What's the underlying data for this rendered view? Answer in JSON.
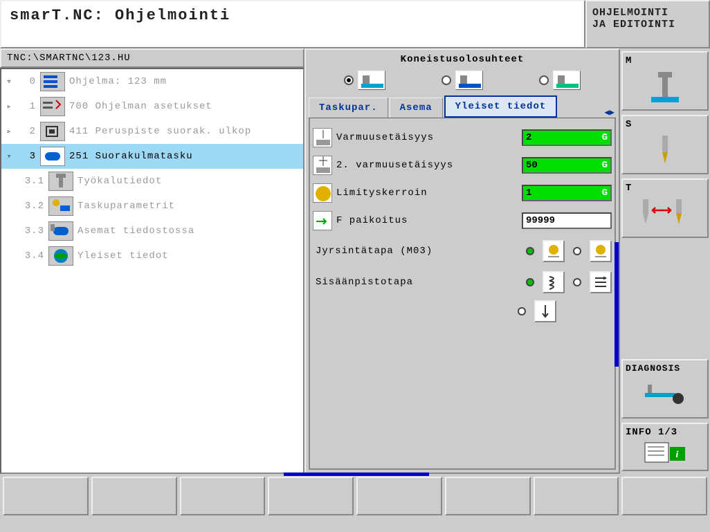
{
  "header": {
    "title": "smarT.NC: Ohjelmointi",
    "mode_line1": "OHJELMOINTI",
    "mode_line2": "JA EDITOINTI"
  },
  "file_path": "TNC:\\SMARTNC\\123.HU",
  "tree": [
    {
      "toggle": "▿",
      "num": "0",
      "label": "Ohjelma: 123 mm",
      "icon": "program"
    },
    {
      "toggle": "▹",
      "num": "1",
      "label": "700 Ohjelman asetukset",
      "icon": "settings"
    },
    {
      "toggle": "▹",
      "num": "2",
      "label": "411 Peruspiste suorak. ulkop",
      "icon": "datum"
    },
    {
      "toggle": "▿",
      "num": "3",
      "label": "251 Suorakulmatasku",
      "icon": "pocket",
      "selected": true
    },
    {
      "toggle": "",
      "num": "3.1",
      "label": "Työkalutiedot",
      "icon": "tool",
      "child": true
    },
    {
      "toggle": "",
      "num": "3.2",
      "label": "Taskuparametrit",
      "icon": "taskupar",
      "child": true
    },
    {
      "toggle": "",
      "num": "3.3",
      "label": "Asemat tiedostossa",
      "icon": "positions",
      "child": true
    },
    {
      "toggle": "",
      "num": "3.4",
      "label": "Yleiset tiedot",
      "icon": "global",
      "child": true
    }
  ],
  "panel": {
    "title": "Koneistusolosuhteet",
    "tabs": [
      {
        "label": "Taskupar."
      },
      {
        "label": "Asema"
      },
      {
        "label": "Yleiset tiedot",
        "active": true
      }
    ],
    "params": [
      {
        "label": "Varmuusetäisyys",
        "value": "2",
        "suffix": "G",
        "color": "green"
      },
      {
        "label": "2. varmuusetäisyys",
        "value": "50",
        "suffix": "G",
        "color": "green"
      },
      {
        "label": "Limityskerroin",
        "value": "1",
        "suffix": "G",
        "color": "green"
      },
      {
        "label": "F paikoitus",
        "value": "99999",
        "suffix": "",
        "color": "white"
      }
    ],
    "milling_label": "Jyrsintätapa (M03)",
    "plunge_label": "Sisäänpistotapa"
  },
  "sidebar": {
    "m": "M",
    "s": "S",
    "t": "T",
    "diagnosis": "DIAGNOSIS",
    "info": "INFO 1/3"
  }
}
